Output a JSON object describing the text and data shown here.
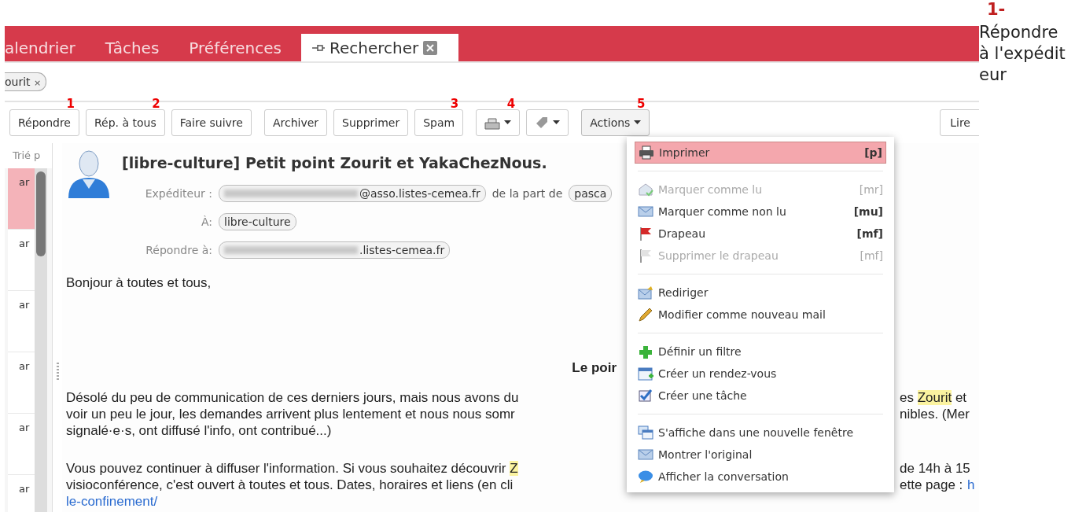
{
  "tabs": [
    {
      "label": "alendrier",
      "selected": false,
      "pinned": false
    },
    {
      "label": "Tâches",
      "selected": false,
      "pinned": false
    },
    {
      "label": "Préférences",
      "selected": false,
      "pinned": false
    },
    {
      "label": "Rechercher",
      "selected": true,
      "pinned": true
    }
  ],
  "search_chips": [
    {
      "label": "ourit",
      "remove": "×"
    }
  ],
  "toolbar": [
    [
      {
        "kind": "text",
        "label": "Répondre",
        "marker": "1"
      },
      {
        "kind": "text",
        "label": "Rép. à tous",
        "marker": "2"
      },
      {
        "kind": "text",
        "label": "Faire suivre"
      }
    ],
    [
      {
        "kind": "text",
        "label": "Archiver"
      },
      {
        "kind": "text",
        "label": "Supprimer"
      },
      {
        "kind": "text",
        "label": "Spam",
        "marker": "3"
      }
    ],
    [
      {
        "kind": "print",
        "marker": "4"
      },
      {
        "kind": "tag"
      }
    ],
    [
      {
        "kind": "menu",
        "label": "Actions",
        "marker": "5",
        "expanded": true
      }
    ],
    [
      {
        "kind": "end",
        "label": "Lire"
      }
    ]
  ],
  "message_list": {
    "header": "Trié p",
    "rows": [
      {
        "text": "ar",
        "selected": true
      },
      {
        "text": "ar",
        "selected": false
      },
      {
        "text": "ar",
        "selected": false
      },
      {
        "text": "ar",
        "selected": false
      },
      {
        "text": "ar",
        "selected": false
      },
      {
        "text": "ar",
        "selected": false
      }
    ]
  },
  "message": {
    "subject": "[libre-culture] Petit point Zourit et YakaChezNous.",
    "fields": [
      {
        "label": "Expéditeur :",
        "chips": [
          {
            "text": "@asso.listes-cemea.fr",
            "blurred": true
          }
        ],
        "after": "de la part de",
        "chip2": "pasca"
      },
      {
        "label": "À:",
        "chips": [
          {
            "text": "libre-culture",
            "blurred": false
          }
        ]
      },
      {
        "label": "Répondre à:",
        "chips": [
          {
            "text": ".listes-cemea.fr",
            "blurred": true
          }
        ]
      }
    ],
    "greeting": "Bonjour à toutes et tous,",
    "heading": "Le poir",
    "paragraphs": [
      [
        {
          "left": [
            {
              "text": "Désolé du peu de communication de ces derniers jours, mais nous avons du",
              "highlight": false
            }
          ],
          "right": [
            {
              "text": "es ",
              "highlight": false
            },
            {
              "text": "Zourit",
              "highlight": true
            },
            {
              "text": " et",
              "highlight": false
            }
          ]
        },
        {
          "left": [
            {
              "text": "voir un peu le jour, les demandes arrivent plus lentement et nous nous somr",
              "highlight": false
            }
          ],
          "right": [
            {
              "text": "nibles. (Mer",
              "highlight": false
            }
          ]
        },
        {
          "left": [
            {
              "text": "signalé·e·s, ont diffusé l'info, ont contribué...)",
              "highlight": false
            }
          ]
        }
      ],
      [
        {
          "left": [
            {
              "text": "Vous pouvez continuer à diffuser l'information. Si vous souhaitez découvrir ",
              "highlight": false
            },
            {
              "text": "Z",
              "highlight": true
            }
          ],
          "right": [
            {
              "text": "de 14h à 15",
              "highlight": false
            }
          ]
        },
        {
          "left": [
            {
              "text": "visioconférence, c'est ouvert à toutes et tous. Dates, horaires et liens (en cli",
              "highlight": false
            }
          ],
          "right": [
            {
              "text": "ette page : ",
              "highlight": false
            }
          ],
          "link": "h"
        },
        {
          "link": "le-confinement/"
        }
      ]
    ]
  },
  "actions_menu": [
    {
      "kind": "item",
      "label": "Imprimer",
      "shortcut": "[p]",
      "selected": true,
      "disabled": false
    },
    {
      "kind": "separator"
    },
    {
      "kind": "item",
      "label": "Marquer comme lu",
      "shortcut": "[mr]",
      "selected": false,
      "disabled": true
    },
    {
      "kind": "item",
      "label": "Marquer comme non lu",
      "shortcut": "[mu]",
      "selected": false,
      "disabled": false
    },
    {
      "kind": "item",
      "label": "Drapeau",
      "shortcut": "[mf]",
      "selected": false,
      "disabled": false
    },
    {
      "kind": "item",
      "label": "Supprimer le drapeau",
      "shortcut": "[mf]",
      "selected": false,
      "disabled": true
    },
    {
      "kind": "separator"
    },
    {
      "kind": "item",
      "label": "Rediriger",
      "selected": false,
      "disabled": false
    },
    {
      "kind": "item",
      "label": "Modifier comme nouveau mail",
      "selected": false,
      "disabled": false
    },
    {
      "kind": "separator"
    },
    {
      "kind": "item",
      "label": "Définir un filtre",
      "selected": false,
      "disabled": false
    },
    {
      "kind": "item",
      "label": "Créer un rendez-vous",
      "selected": false,
      "disabled": false
    },
    {
      "kind": "item",
      "label": "Créer une tâche",
      "selected": false,
      "disabled": false
    },
    {
      "kind": "separator"
    },
    {
      "kind": "item",
      "label": "S'affiche dans une nouvelle fenêtre",
      "selected": false,
      "disabled": false
    },
    {
      "kind": "item",
      "label": "Montrer l'original",
      "selected": false,
      "disabled": false
    },
    {
      "kind": "item",
      "label": "Afficher la conversation",
      "selected": false,
      "disabled": false
    }
  ],
  "doc_sidebar": {
    "number": "1-",
    "text": "Répondre à l'expéditeur"
  }
}
